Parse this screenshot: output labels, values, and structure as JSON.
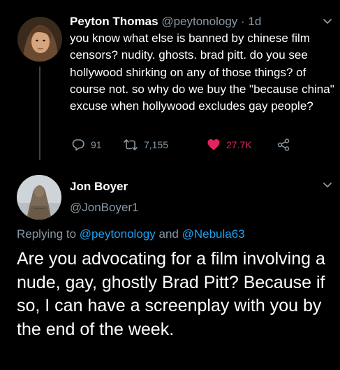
{
  "tweet1": {
    "author_name": "Peyton Thomas",
    "author_handle": "@peytonology",
    "separator": "·",
    "timestamp": "1d",
    "text": "you know what else is banned by chinese film censors? nudity. ghosts. brad pitt. do you see hollywood shirking on any of those things? of course not. so why do we buy the \"because china\" excuse when hollywood excludes gay people?",
    "reply_count": "91",
    "retweet_count": "7,155",
    "like_count": "27.7K",
    "liked": true
  },
  "tweet2": {
    "author_name": "Jon Boyer",
    "author_handle": "@JonBoyer1",
    "replying_prefix": "Replying to",
    "replying_user1": "@peytonology",
    "replying_and": "and",
    "replying_user2": "@Nebula63",
    "text": "Are you advocating for a film involving a nude, gay, ghostly Brad Pitt? Because if so, I can have a screenplay with you by the end of the week."
  },
  "icons": {
    "reply": "reply-icon",
    "retweet": "retweet-icon",
    "like": "heart-icon",
    "share": "share-icon",
    "more": "chevron-down-icon"
  },
  "colors": {
    "background": "#000000",
    "text": "#ffffff",
    "muted": "#8899a6",
    "link": "#1da1f2",
    "like": "#e0245e",
    "thread_line": "#38444d"
  }
}
